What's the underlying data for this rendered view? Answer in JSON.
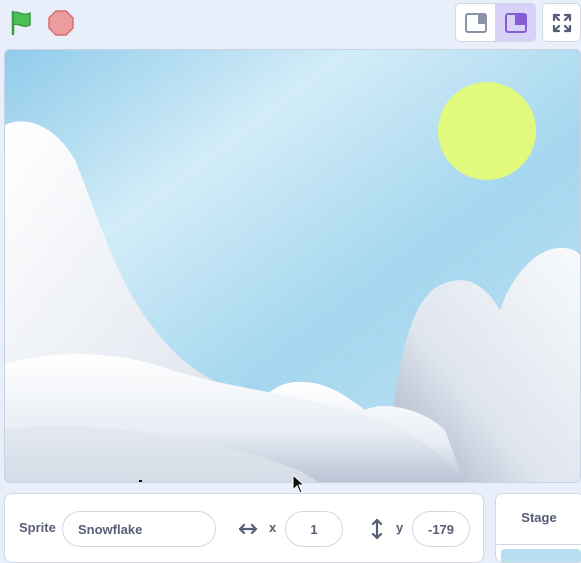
{
  "toolbar": {
    "green_flag_icon": "green-flag-icon",
    "stop_icon": "stop-sign-icon",
    "small_stage_icon": "small-stage-layout-icon",
    "large_stage_icon": "large-stage-layout-icon",
    "fullscreen_icon": "fullscreen-icon"
  },
  "colors": {
    "green_flag": "#4cbf56",
    "stop": "#ec9c9c",
    "accent": "#855cd6",
    "sun": "#e1f97c",
    "sky": "#a9d9ef"
  },
  "sprite_info": {
    "sprite_label": "Sprite",
    "sprite_name": "Snowflake",
    "x_label": "x",
    "x_value": "1",
    "y_label": "y",
    "y_value": "-179"
  },
  "stage_panel": {
    "title": "Stage"
  }
}
